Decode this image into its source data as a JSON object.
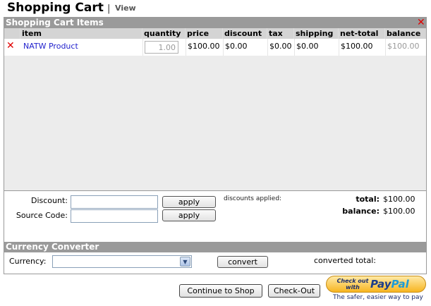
{
  "header": {
    "title": "Shopping Cart",
    "separator": "|",
    "view": "View"
  },
  "cart": {
    "section_title": "Shopping Cart Items",
    "close_icon": "close-x-icon",
    "columns": [
      "item",
      "quantity",
      "price",
      "discount",
      "tax",
      "shipping",
      "net-total",
      "balance"
    ],
    "rows": [
      {
        "item": "NATW Product",
        "quantity": "1.00",
        "price": "$100.00",
        "discount": "$0.00",
        "tax": "$0.00",
        "shipping": "$0.00",
        "net_total": "$100.00",
        "balance": "$100.00"
      }
    ]
  },
  "discount": {
    "discount_label": "Discount:",
    "source_label": "Source Code:",
    "discount_value": "",
    "source_value": "",
    "apply_label": "apply",
    "applied_text": "discounts applied:"
  },
  "totals": {
    "total_label": "total:",
    "total_value": "$100.00",
    "balance_label": "balance:",
    "balance_value": "$100.00"
  },
  "converter": {
    "title": "Currency Converter",
    "currency_label": "Currency:",
    "currency_value": "",
    "convert_label": "convert",
    "converted_label": "converted total:"
  },
  "actions": {
    "continue_label": "Continue to Shop",
    "checkout_label": "Check-Out",
    "paypal_small": "Check out with",
    "paypal_logo_a": "Pay",
    "paypal_logo_b": "Pal",
    "paypal_tagline": "The safer, easier way to pay"
  },
  "colors": {
    "header_bg": "#9a9a9a",
    "link": "#1f1fcc",
    "remove": "#e00000"
  }
}
